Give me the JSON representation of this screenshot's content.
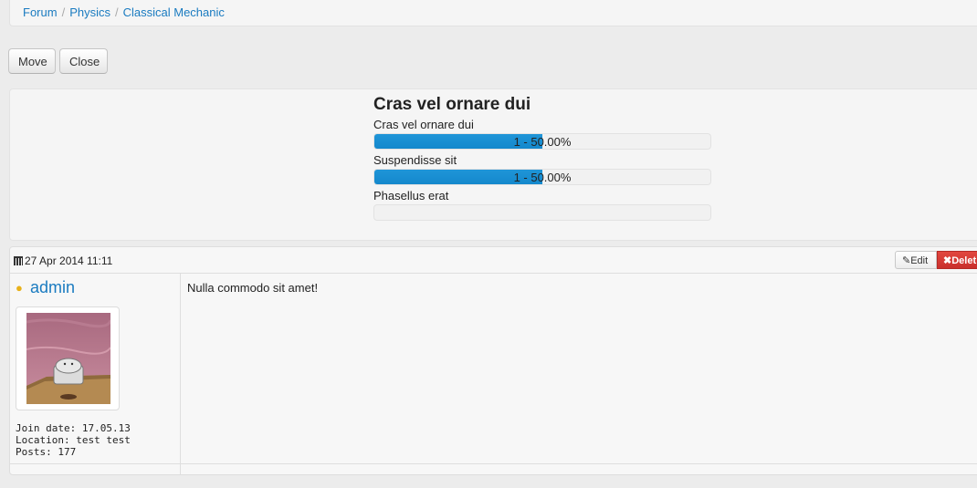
{
  "breadcrumb": {
    "items": [
      "Forum",
      "Physics",
      "Classical Mechanic"
    ],
    "separator": "/"
  },
  "actions": {
    "move": "Move",
    "close": "Close"
  },
  "poll": {
    "title": "Cras vel ornare dui",
    "options": [
      {
        "label": "Cras vel ornare dui",
        "bar_text": "1 - 50.00%",
        "percent": 50
      },
      {
        "label": "Suspendisse sit",
        "bar_text": "1 - 50.00%",
        "percent": 50
      },
      {
        "label": "Phasellus erat",
        "bar_text": "",
        "percent": 0
      }
    ],
    "bar_color": "#1488cc"
  },
  "post": {
    "date": "27 Apr 2014 11:11",
    "edit_label": "Edit",
    "delete_label": "Delet",
    "username": "admin",
    "user_info": {
      "join_date": "Join date: 17.05.13",
      "location": "Location: test test",
      "posts": "Posts: 177"
    },
    "body": "Nulla commodo sit amet!"
  },
  "colors": {
    "link": "#1a7bc0",
    "delete_button": "#d9433d"
  },
  "icons": [
    "calendar-icon",
    "lightbulb-icon",
    "edit-icon",
    "delete-icon"
  ]
}
